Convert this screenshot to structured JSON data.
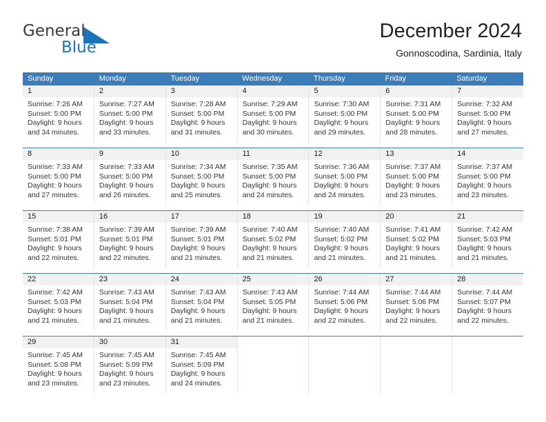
{
  "logo": {
    "word1": "General",
    "word2": "Blue",
    "triangle_color": "#1b74bb",
    "word2_color": "#1b74bb"
  },
  "header": {
    "title": "December 2024",
    "subtitle": "Gonnoscodina, Sardinia, Italy"
  },
  "theme": {
    "header_blue": "#3c7cb8",
    "daynum_band": "#f1f1f1",
    "cell_border": "#e3e3e3"
  },
  "weekdays": [
    "Sunday",
    "Monday",
    "Tuesday",
    "Wednesday",
    "Thursday",
    "Friday",
    "Saturday"
  ],
  "weeks": [
    [
      {
        "day": "1",
        "l1": "Sunrise: 7:26 AM",
        "l2": "Sunset: 5:00 PM",
        "l3": "Daylight: 9 hours",
        "l4": "and 34 minutes."
      },
      {
        "day": "2",
        "l1": "Sunrise: 7:27 AM",
        "l2": "Sunset: 5:00 PM",
        "l3": "Daylight: 9 hours",
        "l4": "and 33 minutes."
      },
      {
        "day": "3",
        "l1": "Sunrise: 7:28 AM",
        "l2": "Sunset: 5:00 PM",
        "l3": "Daylight: 9 hours",
        "l4": "and 31 minutes."
      },
      {
        "day": "4",
        "l1": "Sunrise: 7:29 AM",
        "l2": "Sunset: 5:00 PM",
        "l3": "Daylight: 9 hours",
        "l4": "and 30 minutes."
      },
      {
        "day": "5",
        "l1": "Sunrise: 7:30 AM",
        "l2": "Sunset: 5:00 PM",
        "l3": "Daylight: 9 hours",
        "l4": "and 29 minutes."
      },
      {
        "day": "6",
        "l1": "Sunrise: 7:31 AM",
        "l2": "Sunset: 5:00 PM",
        "l3": "Daylight: 9 hours",
        "l4": "and 28 minutes."
      },
      {
        "day": "7",
        "l1": "Sunrise: 7:32 AM",
        "l2": "Sunset: 5:00 PM",
        "l3": "Daylight: 9 hours",
        "l4": "and 27 minutes."
      }
    ],
    [
      {
        "day": "8",
        "l1": "Sunrise: 7:33 AM",
        "l2": "Sunset: 5:00 PM",
        "l3": "Daylight: 9 hours",
        "l4": "and 27 minutes."
      },
      {
        "day": "9",
        "l1": "Sunrise: 7:33 AM",
        "l2": "Sunset: 5:00 PM",
        "l3": "Daylight: 9 hours",
        "l4": "and 26 minutes."
      },
      {
        "day": "10",
        "l1": "Sunrise: 7:34 AM",
        "l2": "Sunset: 5:00 PM",
        "l3": "Daylight: 9 hours",
        "l4": "and 25 minutes."
      },
      {
        "day": "11",
        "l1": "Sunrise: 7:35 AM",
        "l2": "Sunset: 5:00 PM",
        "l3": "Daylight: 9 hours",
        "l4": "and 24 minutes."
      },
      {
        "day": "12",
        "l1": "Sunrise: 7:36 AM",
        "l2": "Sunset: 5:00 PM",
        "l3": "Daylight: 9 hours",
        "l4": "and 24 minutes."
      },
      {
        "day": "13",
        "l1": "Sunrise: 7:37 AM",
        "l2": "Sunset: 5:00 PM",
        "l3": "Daylight: 9 hours",
        "l4": "and 23 minutes."
      },
      {
        "day": "14",
        "l1": "Sunrise: 7:37 AM",
        "l2": "Sunset: 5:00 PM",
        "l3": "Daylight: 9 hours",
        "l4": "and 23 minutes."
      }
    ],
    [
      {
        "day": "15",
        "l1": "Sunrise: 7:38 AM",
        "l2": "Sunset: 5:01 PM",
        "l3": "Daylight: 9 hours",
        "l4": "and 22 minutes."
      },
      {
        "day": "16",
        "l1": "Sunrise: 7:39 AM",
        "l2": "Sunset: 5:01 PM",
        "l3": "Daylight: 9 hours",
        "l4": "and 22 minutes."
      },
      {
        "day": "17",
        "l1": "Sunrise: 7:39 AM",
        "l2": "Sunset: 5:01 PM",
        "l3": "Daylight: 9 hours",
        "l4": "and 21 minutes."
      },
      {
        "day": "18",
        "l1": "Sunrise: 7:40 AM",
        "l2": "Sunset: 5:02 PM",
        "l3": "Daylight: 9 hours",
        "l4": "and 21 minutes."
      },
      {
        "day": "19",
        "l1": "Sunrise: 7:40 AM",
        "l2": "Sunset: 5:02 PM",
        "l3": "Daylight: 9 hours",
        "l4": "and 21 minutes."
      },
      {
        "day": "20",
        "l1": "Sunrise: 7:41 AM",
        "l2": "Sunset: 5:02 PM",
        "l3": "Daylight: 9 hours",
        "l4": "and 21 minutes."
      },
      {
        "day": "21",
        "l1": "Sunrise: 7:42 AM",
        "l2": "Sunset: 5:03 PM",
        "l3": "Daylight: 9 hours",
        "l4": "and 21 minutes."
      }
    ],
    [
      {
        "day": "22",
        "l1": "Sunrise: 7:42 AM",
        "l2": "Sunset: 5:03 PM",
        "l3": "Daylight: 9 hours",
        "l4": "and 21 minutes."
      },
      {
        "day": "23",
        "l1": "Sunrise: 7:43 AM",
        "l2": "Sunset: 5:04 PM",
        "l3": "Daylight: 9 hours",
        "l4": "and 21 minutes."
      },
      {
        "day": "24",
        "l1": "Sunrise: 7:43 AM",
        "l2": "Sunset: 5:04 PM",
        "l3": "Daylight: 9 hours",
        "l4": "and 21 minutes."
      },
      {
        "day": "25",
        "l1": "Sunrise: 7:43 AM",
        "l2": "Sunset: 5:05 PM",
        "l3": "Daylight: 9 hours",
        "l4": "and 21 minutes."
      },
      {
        "day": "26",
        "l1": "Sunrise: 7:44 AM",
        "l2": "Sunset: 5:06 PM",
        "l3": "Daylight: 9 hours",
        "l4": "and 22 minutes."
      },
      {
        "day": "27",
        "l1": "Sunrise: 7:44 AM",
        "l2": "Sunset: 5:06 PM",
        "l3": "Daylight: 9 hours",
        "l4": "and 22 minutes."
      },
      {
        "day": "28",
        "l1": "Sunrise: 7:44 AM",
        "l2": "Sunset: 5:07 PM",
        "l3": "Daylight: 9 hours",
        "l4": "and 22 minutes."
      }
    ],
    [
      {
        "day": "29",
        "l1": "Sunrise: 7:45 AM",
        "l2": "Sunset: 5:08 PM",
        "l3": "Daylight: 9 hours",
        "l4": "and 23 minutes."
      },
      {
        "day": "30",
        "l1": "Sunrise: 7:45 AM",
        "l2": "Sunset: 5:09 PM",
        "l3": "Daylight: 9 hours",
        "l4": "and 23 minutes."
      },
      {
        "day": "31",
        "l1": "Sunrise: 7:45 AM",
        "l2": "Sunset: 5:09 PM",
        "l3": "Daylight: 9 hours",
        "l4": "and 24 minutes."
      },
      {
        "day": "",
        "l1": "",
        "l2": "",
        "l3": "",
        "l4": ""
      },
      {
        "day": "",
        "l1": "",
        "l2": "",
        "l3": "",
        "l4": ""
      },
      {
        "day": "",
        "l1": "",
        "l2": "",
        "l3": "",
        "l4": ""
      },
      {
        "day": "",
        "l1": "",
        "l2": "",
        "l3": "",
        "l4": ""
      }
    ]
  ]
}
